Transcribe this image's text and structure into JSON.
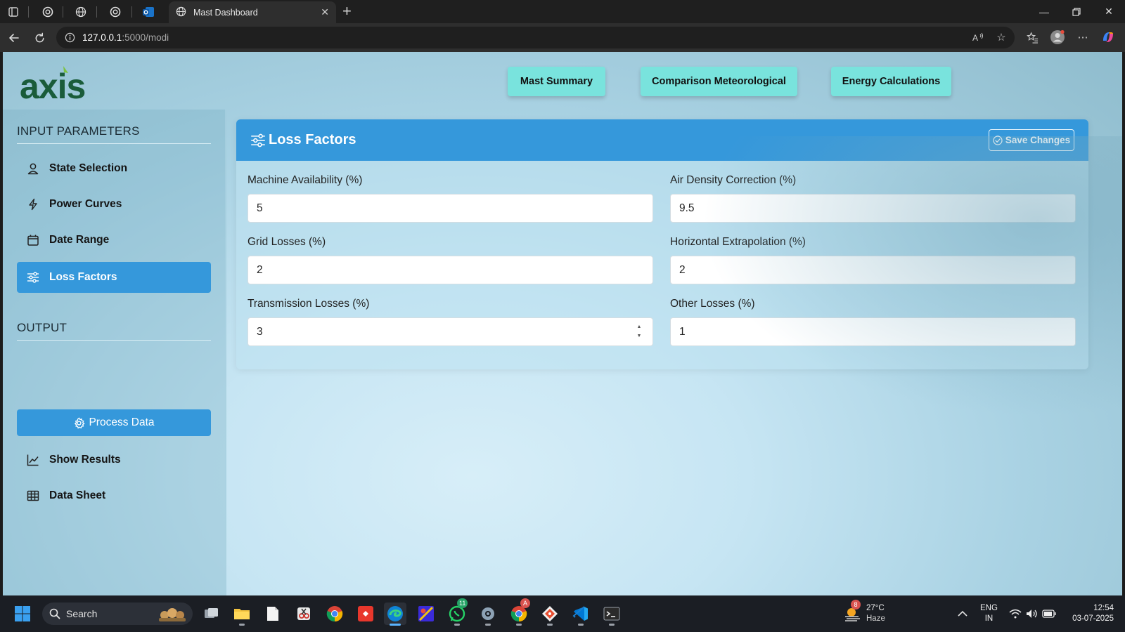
{
  "browser": {
    "active_tab_title": "Mast Dashboard",
    "url_host": "127.0.0.1",
    "url_rest": ":5000/modi"
  },
  "header": {
    "logo_text": "axis",
    "nav": [
      {
        "label": "Mast Summary"
      },
      {
        "label": "Comparison Meteorological"
      },
      {
        "label": "Energy Calculations"
      }
    ]
  },
  "sidebar": {
    "input_title": "INPUT PARAMETERS",
    "items": [
      {
        "label": "State Selection",
        "icon": "person-icon"
      },
      {
        "label": "Power Curves",
        "icon": "lightning-icon"
      },
      {
        "label": "Date Range",
        "icon": "calendar-icon"
      },
      {
        "label": "Loss Factors",
        "icon": "sliders-icon",
        "active": true
      }
    ],
    "output_title": "OUTPUT",
    "process_label": "Process Data",
    "output_items": [
      {
        "label": "Show Results",
        "icon": "chart-line-icon"
      },
      {
        "label": "Data Sheet",
        "icon": "table-icon"
      }
    ]
  },
  "card": {
    "title": "Loss Factors",
    "save_label": "Save Changes",
    "fields": [
      {
        "label": "Machine Availability (%)",
        "value": "5"
      },
      {
        "label": "Air Density Correction (%)",
        "value": "9.5"
      },
      {
        "label": "Grid Losses (%)",
        "value": "2"
      },
      {
        "label": "Horizontal Extrapolation (%)",
        "value": "2"
      },
      {
        "label": "Transmission Losses (%)",
        "value": "3"
      },
      {
        "label": "Other Losses (%)",
        "value": "1"
      }
    ]
  },
  "taskbar": {
    "search_label": "Search",
    "weather_temp": "27°C",
    "weather_desc": "Haze",
    "weather_badge": "8",
    "whatsapp_badge": "11",
    "chrome_badge": "A",
    "lang_top": "ENG",
    "lang_bottom": "IN",
    "time": "12:54",
    "date": "03-07-2025"
  },
  "colors": {
    "primary": "#3598db",
    "nav_button": "#79e3dd",
    "logo_green": "#1a5c3a"
  }
}
